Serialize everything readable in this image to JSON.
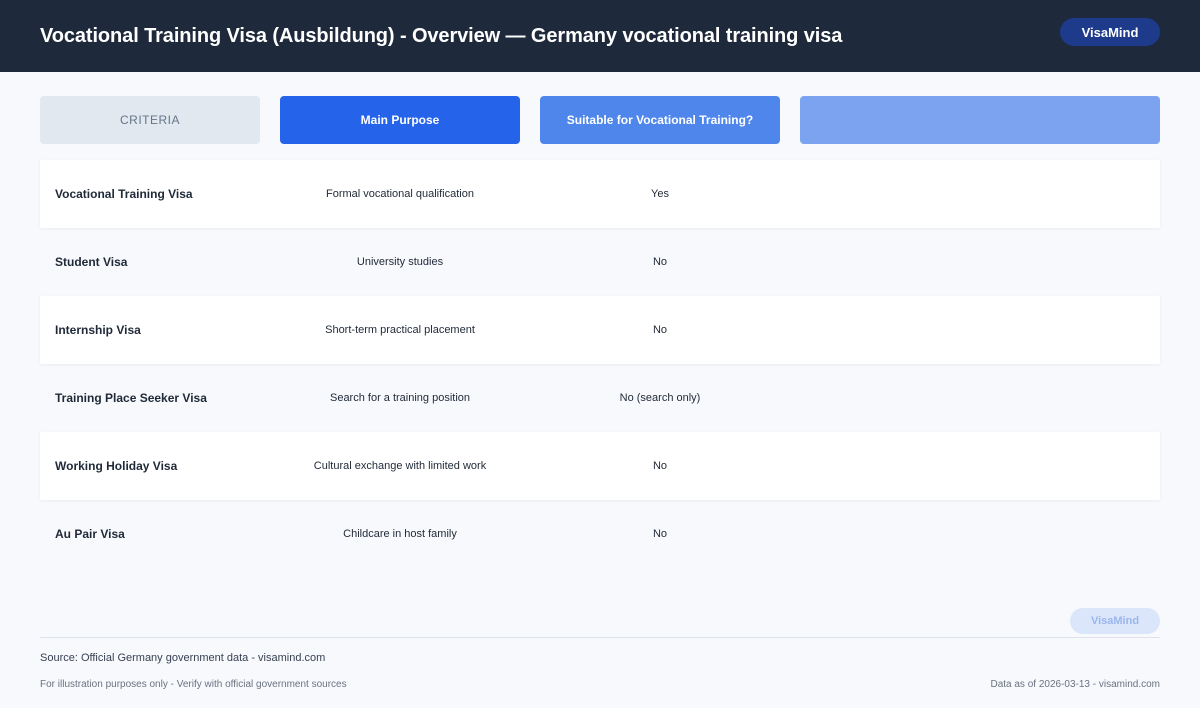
{
  "header": {
    "title": "Vocational Training Visa (Ausbildung) - Overview — Germany vocational training visa",
    "brand": "VisaMind"
  },
  "columns": {
    "criteria": "CRITERIA",
    "main_purpose": "Main Purpose",
    "suitable": "Suitable for Vocational Training?",
    "extra": ""
  },
  "rows": [
    {
      "name": "Vocational Training Visa",
      "purpose": "Formal vocational qualification",
      "suitable": "Yes"
    },
    {
      "name": "Student Visa",
      "purpose": "University studies",
      "suitable": "No"
    },
    {
      "name": "Internship Visa",
      "purpose": "Short-term practical placement",
      "suitable": "No"
    },
    {
      "name": "Training Place Seeker Visa",
      "purpose": "Search for a training position",
      "suitable": "No (search only)"
    },
    {
      "name": "Working Holiday Visa",
      "purpose": "Cultural exchange with limited work",
      "suitable": "No"
    },
    {
      "name": "Au Pair Visa",
      "purpose": "Childcare in host family",
      "suitable": "No"
    }
  ],
  "watermark": "VisaMind",
  "footer": {
    "source": "Source: Official Germany government data - visamind.com",
    "disclaimer": "For illustration purposes only - Verify with official government sources",
    "data_date": "Data as of 2026-03-13 - visamind.com"
  },
  "colors": {
    "header_bg": "#1e293b",
    "accent": "#2563eb",
    "brand_badge": "#1e3a8a"
  }
}
